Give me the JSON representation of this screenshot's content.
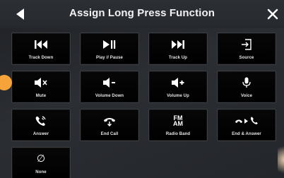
{
  "header": {
    "title": "Assign Long Press Function"
  },
  "tiles": [
    {
      "label": "Track Down",
      "icon": "track-down-icon"
    },
    {
      "label": "Play // Pause",
      "icon": "play-pause-icon"
    },
    {
      "label": "Track Up",
      "icon": "track-up-icon"
    },
    {
      "label": "Source",
      "icon": "source-icon"
    },
    {
      "label": "Mute",
      "icon": "mute-icon"
    },
    {
      "label": "Volume Down",
      "icon": "volume-down-icon"
    },
    {
      "label": "Volume Up",
      "icon": "volume-up-icon"
    },
    {
      "label": "Voice",
      "icon": "microphone-icon"
    },
    {
      "label": "Answer",
      "icon": "phone-answer-icon"
    },
    {
      "label": "End Call",
      "icon": "phone-end-icon"
    },
    {
      "label": "Radio Band",
      "icon": "fm-am-icon",
      "icon_text_top": "FM",
      "icon_text_bottom": "AM"
    },
    {
      "label": "End & Answer",
      "icon": "end-and-answer-icon"
    },
    {
      "label": "None",
      "icon": "none-icon",
      "icon_text": "∅"
    }
  ],
  "colors": {
    "accent_dot": "#f6a43a",
    "tile_bg": "#000000",
    "screen_bg": "#25282c"
  }
}
